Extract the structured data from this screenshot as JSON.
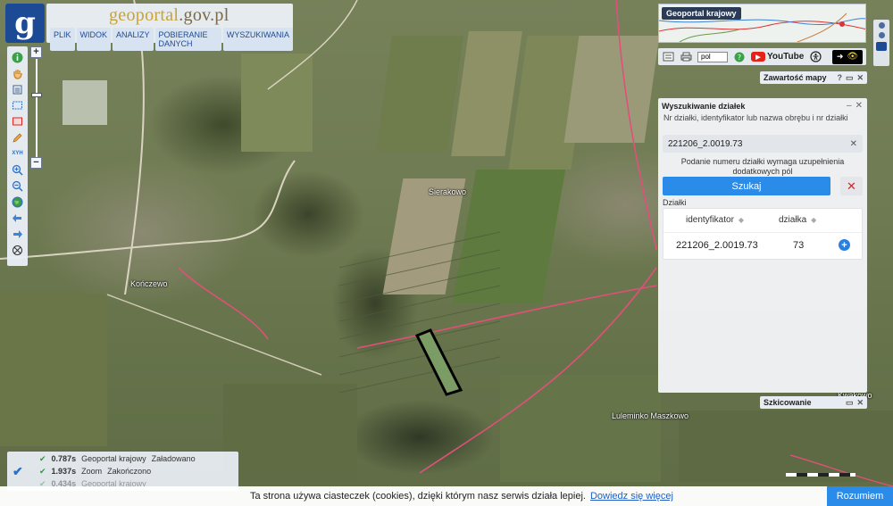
{
  "app": {
    "logo_letter": "g",
    "site_title_1": "geoportal",
    "site_title_2": ".gov.pl"
  },
  "menu": {
    "items": [
      "PLIK",
      "WIDOK",
      "ANALIZY",
      "POBIERANIE DANYCH",
      "WYSZUKIWANIA"
    ]
  },
  "left_tools": [
    {
      "icon": "info-icon"
    },
    {
      "icon": "pan-hand-icon"
    },
    {
      "icon": "layers-icon"
    },
    {
      "icon": "select-area-icon"
    },
    {
      "icon": "measure-icon"
    },
    {
      "icon": "draw-pencil-icon"
    },
    {
      "icon": "coordinates-icon",
      "label": "XYH"
    },
    {
      "icon": "zoom-in-icon"
    },
    {
      "icon": "zoom-out-icon"
    },
    {
      "icon": "globe-icon"
    },
    {
      "icon": "back-arrow-icon"
    },
    {
      "icon": "forward-arrow-icon"
    },
    {
      "icon": "crosshair-icon"
    }
  ],
  "zoom": {
    "plus": "+",
    "minus": "−"
  },
  "overview": {
    "title": "Geoportal krajowy"
  },
  "icon_bar": {
    "language": "pol",
    "youtube_label": "YouTube",
    "eye_arrow": "➜",
    "eye_icon": "👁"
  },
  "panels": {
    "map_contents": "Zawartość mapy",
    "sketching": "Szkicowanie"
  },
  "search": {
    "title": "Wyszukiwanie działek",
    "description": "Nr działki, identyfikator lub nazwa obrębu i nr działki",
    "input_value": "221206_2.0019.73",
    "clear_icon": "✕",
    "note": "Podanie numeru działki wymaga uzupełnienia dodatkowych pól",
    "search_button": "Szukaj",
    "cancel_icon": "✕",
    "section_label": "Działki",
    "columns": [
      "identyfikator",
      "działka"
    ],
    "rows": [
      {
        "identyfikator": "221206_2.0019.73",
        "dzialka": "73"
      }
    ]
  },
  "map_labels": {
    "sierakowo": "Sierakowo",
    "konczewo": "Kończewo",
    "luleminko": "Luleminko Maszkowo",
    "kwakowo": "Kwakowo"
  },
  "status_log": [
    {
      "time": "0.787s",
      "service": "Geoportal krajowy",
      "status": "Załadowano"
    },
    {
      "time": "1.937s",
      "service": "Zoom",
      "status": "Zakończono"
    },
    {
      "time": "0.434s",
      "service": "Geoportal krajowy",
      "status": ""
    }
  ],
  "cookie": {
    "text": "Ta strona używa ciasteczek (cookies), dzięki którym nasz serwis działa lepiej.",
    "link": "Dowiedz się więcej",
    "button": "Rozumiem"
  },
  "colors": {
    "accent": "#2b8be8",
    "brand": "#1d4a94",
    "parcel_fill": "#7fa36a",
    "parcel_stroke": "#000000",
    "boundary": "#e0507a"
  }
}
